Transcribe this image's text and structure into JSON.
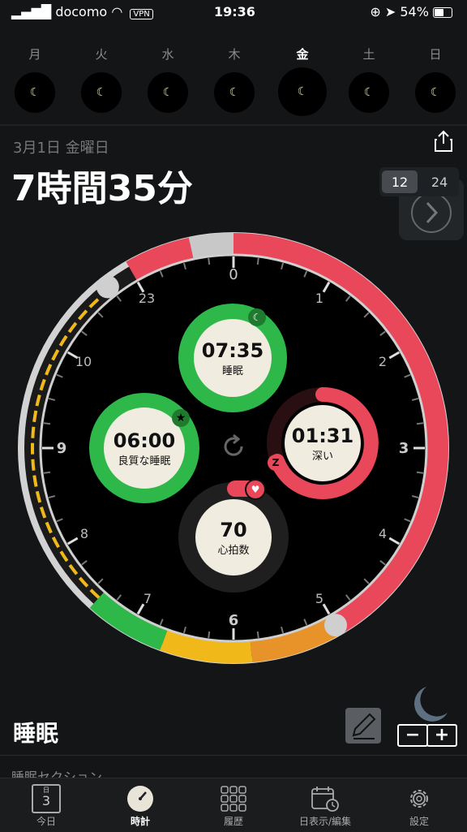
{
  "status": {
    "carrier": "docomo",
    "vpn": "VPN",
    "time": "19:36",
    "battery": "54%"
  },
  "week": [
    {
      "label": "月"
    },
    {
      "label": "火"
    },
    {
      "label": "水"
    },
    {
      "label": "木"
    },
    {
      "label": "金",
      "selected": true
    },
    {
      "label": "土"
    },
    {
      "label": "日"
    }
  ],
  "header": {
    "date": "3月1日 金曜日",
    "total": "7時間35分"
  },
  "toggle": {
    "opt12": "12",
    "opt24": "24"
  },
  "clock": {
    "hours": [
      "0",
      "1",
      "2",
      "3",
      "4",
      "5",
      "6",
      "7",
      "8",
      "9",
      "10",
      "23"
    ],
    "sleep": {
      "value": "07:35",
      "label": "睡眠"
    },
    "good": {
      "value": "06:00",
      "label": "良質な睡眠"
    },
    "deep": {
      "value": "01:31",
      "label": "深い",
      "badge": "Z"
    },
    "heart": {
      "value": "70",
      "label": "心拍数"
    }
  },
  "section": {
    "title": "睡眠",
    "subtitle": "睡眠セクション"
  },
  "tabs": [
    {
      "label": "今日",
      "icon": "calendar-icon",
      "num": "3",
      "small": "日"
    },
    {
      "label": "時計",
      "icon": "clock-icon",
      "selected": true
    },
    {
      "label": "履歴",
      "icon": "grid-icon"
    },
    {
      "label": "日表示/編集",
      "icon": "calendar-edit-icon"
    },
    {
      "label": "設定",
      "icon": "gear-icon"
    }
  ],
  "colors": {
    "green": "#2fb84a",
    "red": "#e8485a",
    "yellow": "#f0b818",
    "orange": "#e8922a",
    "bg": "#131517"
  }
}
